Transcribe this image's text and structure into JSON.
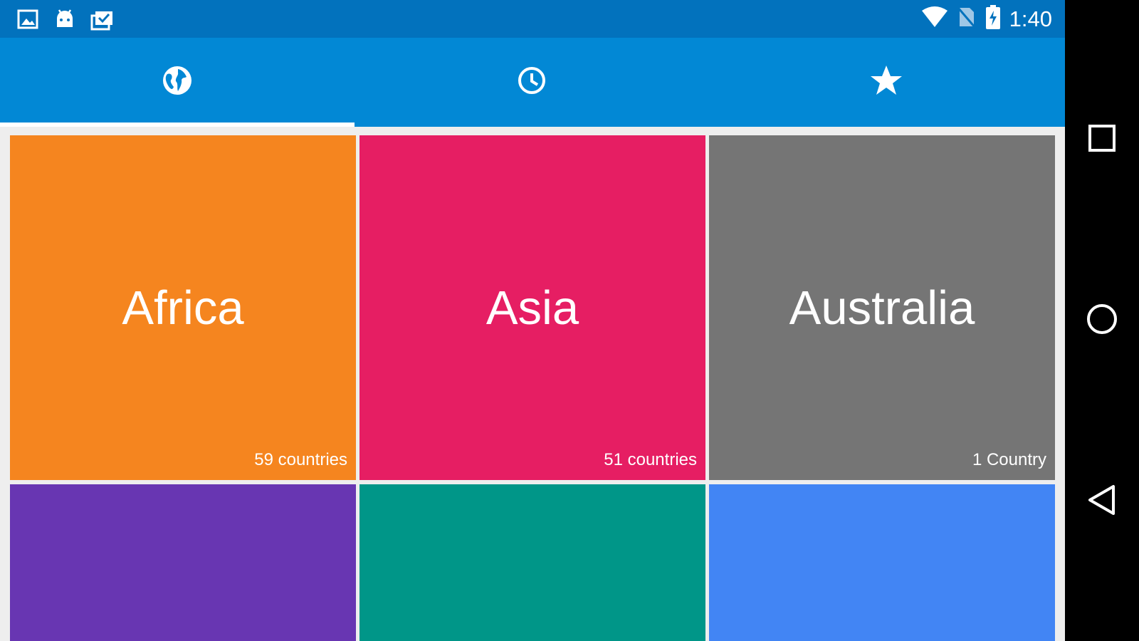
{
  "status_bar": {
    "time": "1:40",
    "left_icons": [
      "image-icon",
      "android-icon",
      "tasks-icon"
    ],
    "right_icons": [
      "wifi-icon",
      "no-sim-icon",
      "battery-charging-icon"
    ]
  },
  "tabs": [
    {
      "icon": "globe-icon",
      "selected": true
    },
    {
      "icon": "clock-icon",
      "selected": false
    },
    {
      "icon": "star-icon",
      "selected": false
    }
  ],
  "continents": [
    {
      "name": "Africa",
      "count": "59 countries",
      "color": "#f5851f"
    },
    {
      "name": "Asia",
      "count": "51 countries",
      "color": "#e61e63"
    },
    {
      "name": "Australia",
      "count": "1 Country",
      "color": "#757575"
    },
    {
      "name": "",
      "count": "",
      "color": "#6836b2"
    },
    {
      "name": "",
      "count": "",
      "color": "#009688"
    },
    {
      "name": "",
      "count": "",
      "color": "#4285f4"
    }
  ],
  "colors": {
    "status_bar": "#0272bd",
    "tab_bar": "#0288d5",
    "background": "#eeeeee"
  }
}
